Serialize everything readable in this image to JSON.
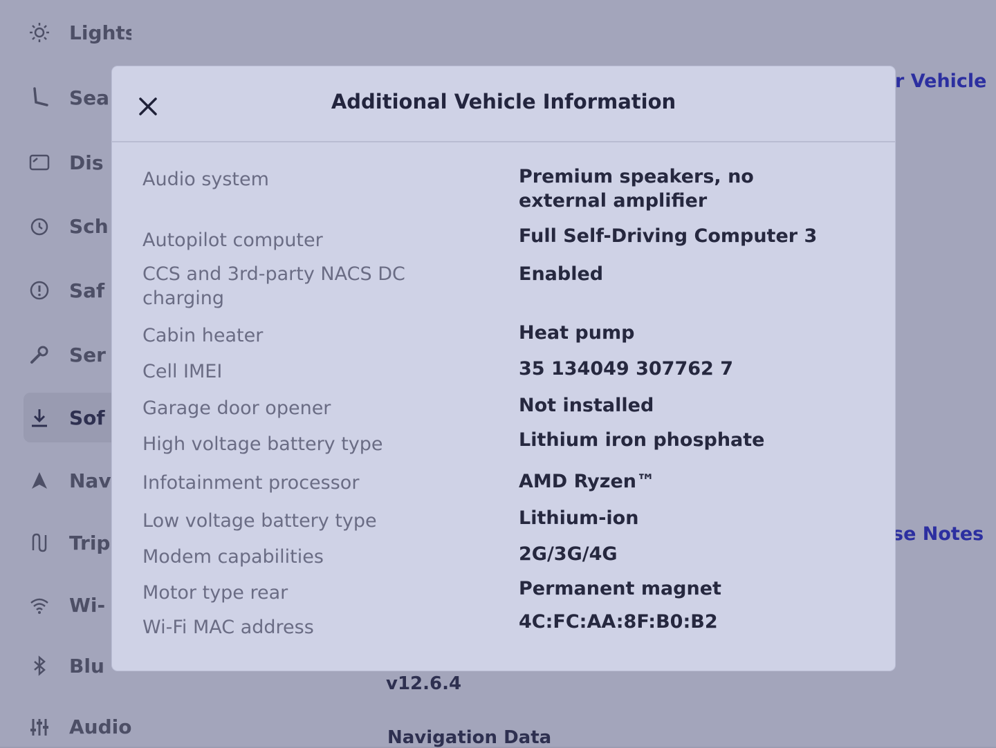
{
  "sidebar": {
    "items": [
      {
        "label": "Lights",
        "icon": "sun-icon"
      },
      {
        "label": "Sea",
        "icon": "seat-icon"
      },
      {
        "label": "Dis",
        "icon": "display-icon"
      },
      {
        "label": "Sch",
        "icon": "alarm-clock-icon"
      },
      {
        "label": "Saf",
        "icon": "alert-circle-icon"
      },
      {
        "label": "Ser",
        "icon": "wrench-icon"
      },
      {
        "label": "Sof",
        "icon": "download-icon",
        "active": true
      },
      {
        "label": "Nav",
        "icon": "navigation-arrow-icon"
      },
      {
        "label": "Trip",
        "icon": "trip-icon"
      },
      {
        "label": "Wi-",
        "icon": "wifi-icon"
      },
      {
        "label": "Blu",
        "icon": "bluetooth-icon"
      },
      {
        "label": "Audio",
        "icon": "equalizer-icon"
      }
    ]
  },
  "background": {
    "right_link_top": "r Vehicle",
    "right_link_notes": "se Notes",
    "version": "v12.6.4",
    "navigation_data": "Navigation Data"
  },
  "modal": {
    "title": "Additional Vehicle Information",
    "close_icon": "close-icon",
    "rows": [
      {
        "label": "Audio system",
        "value": "Premium speakers, no external amplifier"
      },
      {
        "label": "Autopilot computer",
        "value": "Full Self-Driving Computer 3"
      },
      {
        "label": "CCS and 3rd-party NACS DC charging",
        "value": "Enabled"
      },
      {
        "label": "Cabin heater",
        "value": "Heat pump"
      },
      {
        "label": "Cell IMEI",
        "value": "35 134049 307762 7"
      },
      {
        "label": "Garage door opener",
        "value": "Not installed"
      },
      {
        "label": "High voltage battery type",
        "value": "Lithium iron phosphate"
      },
      {
        "label": "Infotainment processor",
        "value": "AMD Ryzen™"
      },
      {
        "label": "Low voltage battery type",
        "value": "Lithium-ion"
      },
      {
        "label": "Modem capabilities",
        "value": "2G/3G/4G"
      },
      {
        "label": "Motor type rear",
        "value": "Permanent magnet"
      },
      {
        "label": "Wi-Fi MAC address",
        "value": "4C:FC:AA:8F:B0:B2"
      }
    ]
  },
  "colors": {
    "modal_bg": "#cfd2e6",
    "link_accent": "#2c2fa0",
    "label_text": "#6a6c84",
    "value_text": "#26283f"
  }
}
